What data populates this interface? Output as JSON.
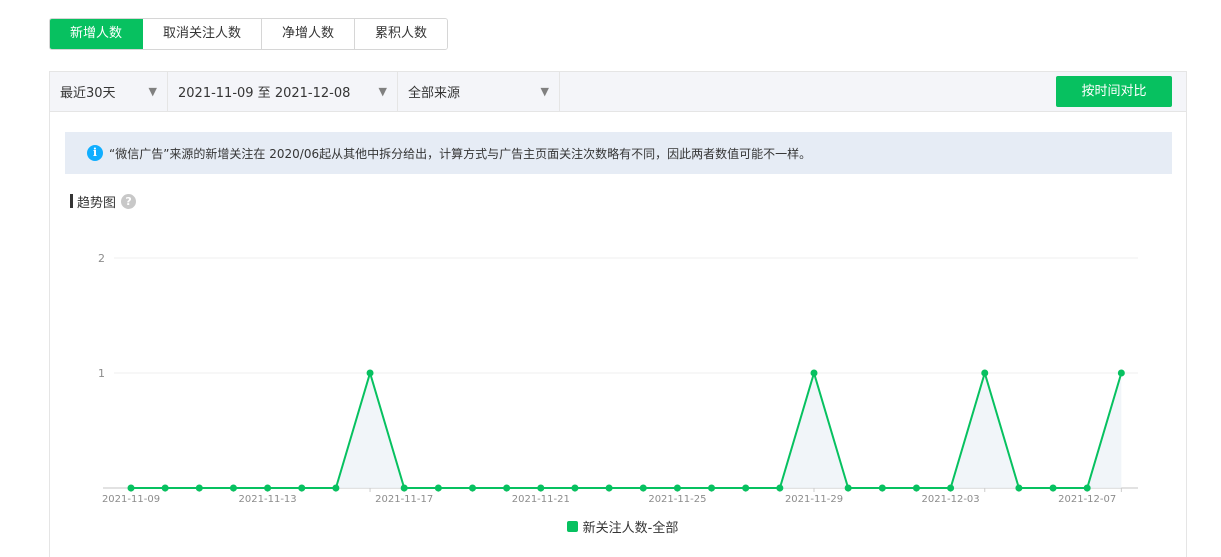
{
  "tabs": [
    {
      "label": "新增人数",
      "active": true
    },
    {
      "label": "取消关注人数",
      "active": false
    },
    {
      "label": "净增人数",
      "active": false
    },
    {
      "label": "累积人数",
      "active": false
    }
  ],
  "filters": {
    "range": "最近30天",
    "date_range": "2021-11-09 至 2021-12-08",
    "source": "全部来源",
    "compare_button": "按时间对比"
  },
  "notice": {
    "text": "“微信广告”来源的新增关注在 2020/06起从其他中拆分给出，计算方式与广告主页面关注次数略有不同，因此两者数值可能不一样。"
  },
  "section": {
    "title": "趋势图"
  },
  "colors": {
    "accent": "#07c160",
    "info": "#10aeff"
  },
  "chart_data": {
    "type": "line",
    "x": [
      "2021-11-09",
      "2021-11-10",
      "2021-11-11",
      "2021-11-12",
      "2021-11-13",
      "2021-11-14",
      "2021-11-15",
      "2021-11-16",
      "2021-11-17",
      "2021-11-18",
      "2021-11-19",
      "2021-11-20",
      "2021-11-21",
      "2021-11-22",
      "2021-11-23",
      "2021-11-24",
      "2021-11-25",
      "2021-11-26",
      "2021-11-27",
      "2021-11-28",
      "2021-11-29",
      "2021-11-30",
      "2021-12-01",
      "2021-12-02",
      "2021-12-03",
      "2021-12-04",
      "2021-12-05",
      "2021-12-06",
      "2021-12-07",
      "2021-12-08"
    ],
    "x_tick_labels": [
      "2021-11-09",
      "2021-11-13",
      "2021-11-17",
      "2021-11-21",
      "2021-11-25",
      "2021-11-29",
      "2021-12-03",
      "2021-12-07"
    ],
    "series": [
      {
        "name": "新关注人数-全部",
        "color": "#07c160",
        "values": [
          0,
          0,
          0,
          0,
          0,
          0,
          0,
          1,
          0,
          0,
          0,
          0,
          0,
          0,
          0,
          0,
          0,
          0,
          0,
          0,
          1,
          0,
          0,
          0,
          0,
          1,
          0,
          0,
          0,
          1
        ]
      }
    ],
    "y_ticks": [
      "1",
      "2"
    ],
    "ylim": [
      0,
      2
    ],
    "grid": true,
    "legend": "bottom-center"
  }
}
